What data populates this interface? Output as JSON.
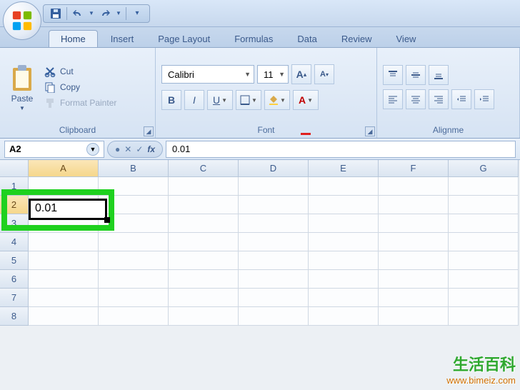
{
  "qat": {
    "save": "save",
    "undo": "undo",
    "redo": "redo"
  },
  "tabs": [
    "Home",
    "Insert",
    "Page Layout",
    "Formulas",
    "Data",
    "Review",
    "View"
  ],
  "active_tab": 0,
  "clipboard": {
    "paste": "Paste",
    "cut": "Cut",
    "copy": "Copy",
    "format_painter": "Format Painter",
    "group_label": "Clipboard"
  },
  "font": {
    "name": "Calibri",
    "size": "11",
    "group_label": "Font"
  },
  "alignment": {
    "group_label": "Alignme"
  },
  "formula_bar": {
    "name_box": "A2",
    "formula": "0.01"
  },
  "columns": [
    "A",
    "B",
    "C",
    "D",
    "E",
    "F",
    "G"
  ],
  "rows": [
    "1",
    "2",
    "3",
    "4",
    "5",
    "6",
    "7",
    "8"
  ],
  "active_col": 0,
  "active_row": 1,
  "cell_value": "0.01",
  "watermark": {
    "cn": "生活百科",
    "en": "www.bimeiz.com"
  }
}
